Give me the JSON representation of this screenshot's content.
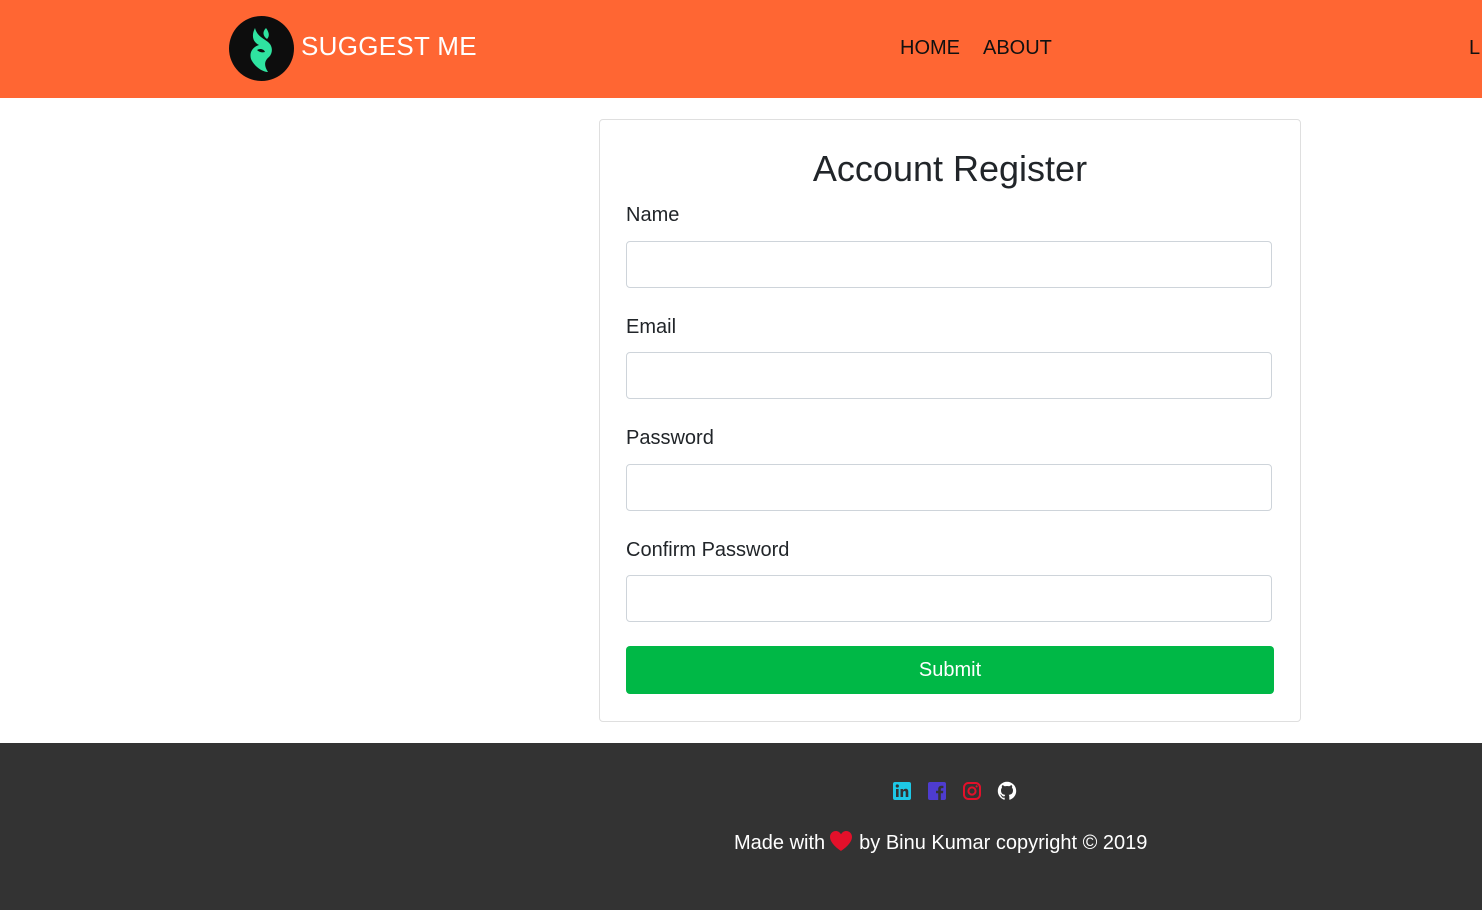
{
  "header": {
    "brand": "SUGGEST ME",
    "nav": [
      {
        "label": "HOME"
      },
      {
        "label": "ABOUT"
      },
      {
        "label": "L"
      }
    ],
    "bg_color": "#ff6633",
    "logo_icon": "leaf-face-logo-icon"
  },
  "form": {
    "title": "Account Register",
    "fields": [
      {
        "label": "Name",
        "value": "",
        "type": "text"
      },
      {
        "label": "Email",
        "value": "",
        "type": "email"
      },
      {
        "label": "Password",
        "value": "",
        "type": "password"
      },
      {
        "label": "Confirm Password",
        "value": "",
        "type": "password"
      }
    ],
    "submit_label": "Submit",
    "submit_color": "#00b846"
  },
  "footer": {
    "social_icons": [
      "linkedin-icon",
      "facebook-icon",
      "instagram-icon",
      "github-icon"
    ],
    "text_before": "Made with",
    "heart_icon": "heart-icon",
    "text_after": "by Binu Kumar copyright © 2019",
    "bg_color": "#333333"
  }
}
